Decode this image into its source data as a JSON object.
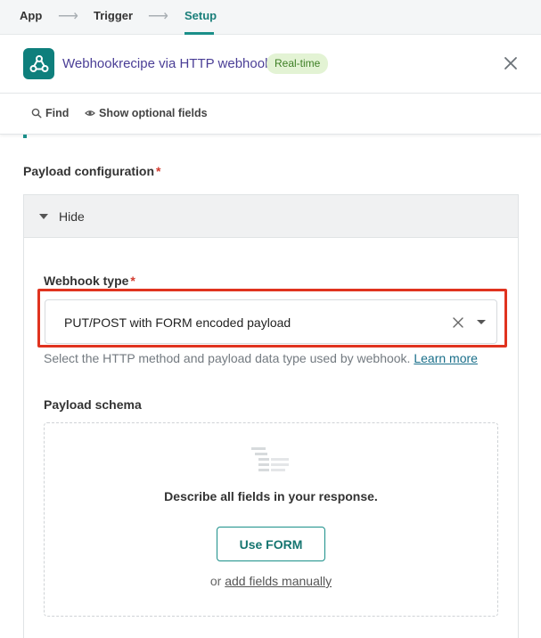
{
  "steps": [
    {
      "label": "App"
    },
    {
      "label": "Trigger"
    },
    {
      "label": "Setup"
    }
  ],
  "header": {
    "title": "Webhookrecipe via HTTP webhook",
    "badge": "Real-time",
    "app_icon": "webhook-icon",
    "close_icon": "close-icon"
  },
  "toolbar": {
    "find_label": "Find",
    "optional_label": "Show optional fields"
  },
  "payload": {
    "label": "Payload configuration",
    "required_mark": "*",
    "toggle_label": "Hide"
  },
  "webhook_type": {
    "label": "Webhook type",
    "required_mark": "*",
    "value": "PUT/POST with FORM encoded payload",
    "help_text": "Select the HTTP method and payload data type used by webhook.",
    "help_link": "Learn more"
  },
  "schema": {
    "label": "Payload schema",
    "description": "Describe all fields in your response.",
    "button_label": "Use FORM",
    "or_text": "or",
    "manual_link": "add fields manually"
  },
  "colors": {
    "accent": "#1a8f89",
    "title": "#4a3e96",
    "highlight": "#e0331f",
    "badge_bg": "#e3f3d4"
  }
}
